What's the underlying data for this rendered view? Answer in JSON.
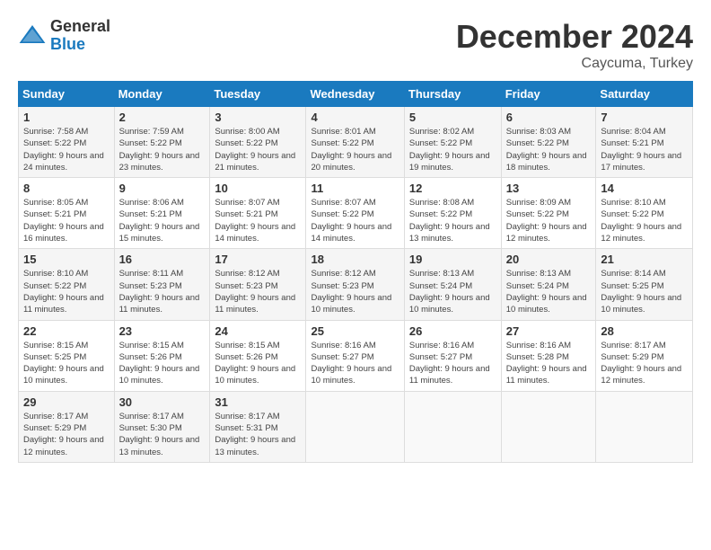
{
  "logo": {
    "general": "General",
    "blue": "Blue"
  },
  "title": {
    "month": "December 2024",
    "location": "Caycuma, Turkey"
  },
  "headers": [
    "Sunday",
    "Monday",
    "Tuesday",
    "Wednesday",
    "Thursday",
    "Friday",
    "Saturday"
  ],
  "weeks": [
    [
      {
        "day": "1",
        "sunrise": "Sunrise: 7:58 AM",
        "sunset": "Sunset: 5:22 PM",
        "daylight": "Daylight: 9 hours and 24 minutes."
      },
      {
        "day": "2",
        "sunrise": "Sunrise: 7:59 AM",
        "sunset": "Sunset: 5:22 PM",
        "daylight": "Daylight: 9 hours and 23 minutes."
      },
      {
        "day": "3",
        "sunrise": "Sunrise: 8:00 AM",
        "sunset": "Sunset: 5:22 PM",
        "daylight": "Daylight: 9 hours and 21 minutes."
      },
      {
        "day": "4",
        "sunrise": "Sunrise: 8:01 AM",
        "sunset": "Sunset: 5:22 PM",
        "daylight": "Daylight: 9 hours and 20 minutes."
      },
      {
        "day": "5",
        "sunrise": "Sunrise: 8:02 AM",
        "sunset": "Sunset: 5:22 PM",
        "daylight": "Daylight: 9 hours and 19 minutes."
      },
      {
        "day": "6",
        "sunrise": "Sunrise: 8:03 AM",
        "sunset": "Sunset: 5:22 PM",
        "daylight": "Daylight: 9 hours and 18 minutes."
      },
      {
        "day": "7",
        "sunrise": "Sunrise: 8:04 AM",
        "sunset": "Sunset: 5:21 PM",
        "daylight": "Daylight: 9 hours and 17 minutes."
      }
    ],
    [
      {
        "day": "8",
        "sunrise": "Sunrise: 8:05 AM",
        "sunset": "Sunset: 5:21 PM",
        "daylight": "Daylight: 9 hours and 16 minutes."
      },
      {
        "day": "9",
        "sunrise": "Sunrise: 8:06 AM",
        "sunset": "Sunset: 5:21 PM",
        "daylight": "Daylight: 9 hours and 15 minutes."
      },
      {
        "day": "10",
        "sunrise": "Sunrise: 8:07 AM",
        "sunset": "Sunset: 5:21 PM",
        "daylight": "Daylight: 9 hours and 14 minutes."
      },
      {
        "day": "11",
        "sunrise": "Sunrise: 8:07 AM",
        "sunset": "Sunset: 5:22 PM",
        "daylight": "Daylight: 9 hours and 14 minutes."
      },
      {
        "day": "12",
        "sunrise": "Sunrise: 8:08 AM",
        "sunset": "Sunset: 5:22 PM",
        "daylight": "Daylight: 9 hours and 13 minutes."
      },
      {
        "day": "13",
        "sunrise": "Sunrise: 8:09 AM",
        "sunset": "Sunset: 5:22 PM",
        "daylight": "Daylight: 9 hours and 12 minutes."
      },
      {
        "day": "14",
        "sunrise": "Sunrise: 8:10 AM",
        "sunset": "Sunset: 5:22 PM",
        "daylight": "Daylight: 9 hours and 12 minutes."
      }
    ],
    [
      {
        "day": "15",
        "sunrise": "Sunrise: 8:10 AM",
        "sunset": "Sunset: 5:22 PM",
        "daylight": "Daylight: 9 hours and 11 minutes."
      },
      {
        "day": "16",
        "sunrise": "Sunrise: 8:11 AM",
        "sunset": "Sunset: 5:23 PM",
        "daylight": "Daylight: 9 hours and 11 minutes."
      },
      {
        "day": "17",
        "sunrise": "Sunrise: 8:12 AM",
        "sunset": "Sunset: 5:23 PM",
        "daylight": "Daylight: 9 hours and 11 minutes."
      },
      {
        "day": "18",
        "sunrise": "Sunrise: 8:12 AM",
        "sunset": "Sunset: 5:23 PM",
        "daylight": "Daylight: 9 hours and 10 minutes."
      },
      {
        "day": "19",
        "sunrise": "Sunrise: 8:13 AM",
        "sunset": "Sunset: 5:24 PM",
        "daylight": "Daylight: 9 hours and 10 minutes."
      },
      {
        "day": "20",
        "sunrise": "Sunrise: 8:13 AM",
        "sunset": "Sunset: 5:24 PM",
        "daylight": "Daylight: 9 hours and 10 minutes."
      },
      {
        "day": "21",
        "sunrise": "Sunrise: 8:14 AM",
        "sunset": "Sunset: 5:25 PM",
        "daylight": "Daylight: 9 hours and 10 minutes."
      }
    ],
    [
      {
        "day": "22",
        "sunrise": "Sunrise: 8:15 AM",
        "sunset": "Sunset: 5:25 PM",
        "daylight": "Daylight: 9 hours and 10 minutes."
      },
      {
        "day": "23",
        "sunrise": "Sunrise: 8:15 AM",
        "sunset": "Sunset: 5:26 PM",
        "daylight": "Daylight: 9 hours and 10 minutes."
      },
      {
        "day": "24",
        "sunrise": "Sunrise: 8:15 AM",
        "sunset": "Sunset: 5:26 PM",
        "daylight": "Daylight: 9 hours and 10 minutes."
      },
      {
        "day": "25",
        "sunrise": "Sunrise: 8:16 AM",
        "sunset": "Sunset: 5:27 PM",
        "daylight": "Daylight: 9 hours and 10 minutes."
      },
      {
        "day": "26",
        "sunrise": "Sunrise: 8:16 AM",
        "sunset": "Sunset: 5:27 PM",
        "daylight": "Daylight: 9 hours and 11 minutes."
      },
      {
        "day": "27",
        "sunrise": "Sunrise: 8:16 AM",
        "sunset": "Sunset: 5:28 PM",
        "daylight": "Daylight: 9 hours and 11 minutes."
      },
      {
        "day": "28",
        "sunrise": "Sunrise: 8:17 AM",
        "sunset": "Sunset: 5:29 PM",
        "daylight": "Daylight: 9 hours and 12 minutes."
      }
    ],
    [
      {
        "day": "29",
        "sunrise": "Sunrise: 8:17 AM",
        "sunset": "Sunset: 5:29 PM",
        "daylight": "Daylight: 9 hours and 12 minutes."
      },
      {
        "day": "30",
        "sunrise": "Sunrise: 8:17 AM",
        "sunset": "Sunset: 5:30 PM",
        "daylight": "Daylight: 9 hours and 13 minutes."
      },
      {
        "day": "31",
        "sunrise": "Sunrise: 8:17 AM",
        "sunset": "Sunset: 5:31 PM",
        "daylight": "Daylight: 9 hours and 13 minutes."
      },
      null,
      null,
      null,
      null
    ]
  ]
}
